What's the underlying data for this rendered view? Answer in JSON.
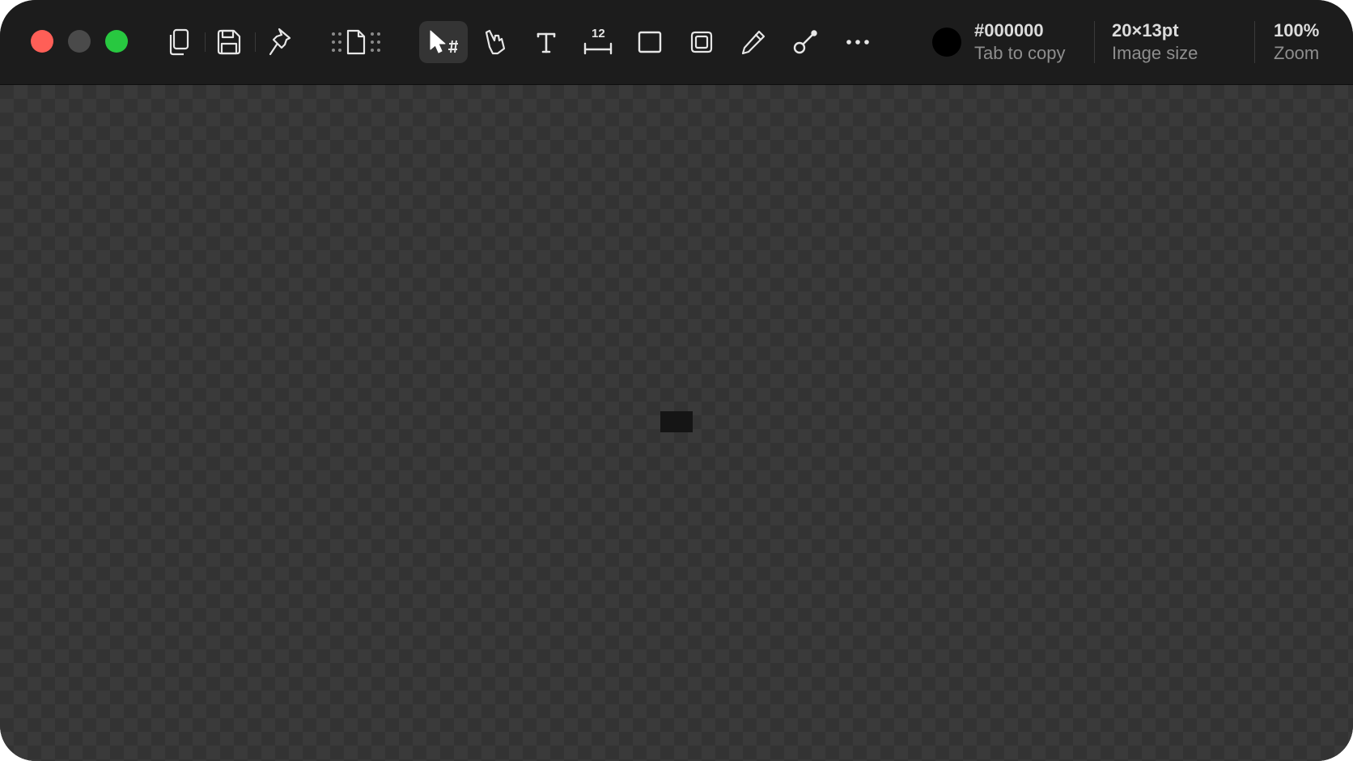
{
  "window": {
    "traffic_lights": {
      "close_color": "#ff5f57",
      "minimize_color": "#4a4a4a",
      "zoom_color": "#28c840"
    }
  },
  "toolbar": {
    "icons": {
      "copy": "copy-icon",
      "save": "save-icon",
      "pin": "pin-icon",
      "canvas_resize": "canvas-resize-icon",
      "select": "select-cursor-icon",
      "pointer": "pointer-hand-icon",
      "text": "text-icon",
      "measure": "measure-ruler-icon",
      "rectangle": "rectangle-icon",
      "frame": "frame-icon",
      "pencil": "pencil-icon",
      "line": "line-icon",
      "more": "more-icon"
    },
    "active_tool": "select",
    "measure_label": "12"
  },
  "color": {
    "swatch_color": "#000000",
    "hex": "#000000",
    "hint": "Tab to copy"
  },
  "image_size": {
    "value": "20×13pt",
    "label": "Image size"
  },
  "zoom": {
    "value": "100%",
    "label": "Zoom"
  },
  "canvas": {
    "checker_dark": "#333333",
    "checker_light": "#3a3a3a",
    "content_color": "#151515"
  }
}
